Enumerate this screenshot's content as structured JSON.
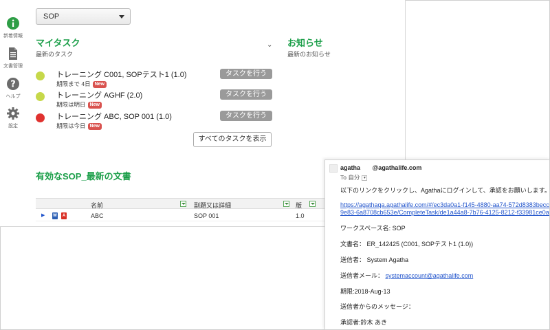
{
  "sidebar": {
    "items": [
      {
        "label": "新着情報",
        "icon": "info-icon"
      },
      {
        "label": "文書管理",
        "icon": "document-icon"
      },
      {
        "label": "ヘルプ",
        "icon": "help-icon"
      },
      {
        "label": "設定",
        "icon": "gear-icon"
      }
    ]
  },
  "workspace_select": {
    "value": "SOP"
  },
  "my_tasks": {
    "title": "マイタスク",
    "subtitle": "最新のタスク",
    "tasks": [
      {
        "title": "トレーニング C001, SOPテスト1 (1.0)",
        "due": "期限まで 4日",
        "badge": "New",
        "status_color": "#c6d84a",
        "action": "タスクを行う"
      },
      {
        "title": "トレーニング AGHF (2.0)",
        "due": "期限は明日",
        "badge": "New",
        "status_color": "#c6d84a",
        "action": "タスクを行う"
      },
      {
        "title": "トレーニング ABC, SOP 001 (1.0)",
        "due": "期限は今日",
        "badge": "New",
        "status_color": "#e0322f",
        "action": "タスクを行う"
      }
    ],
    "show_all": "すべてのタスクを表示"
  },
  "notices": {
    "title": "お知らせ",
    "subtitle": "最新のお知らせ"
  },
  "latest_docs": {
    "title": "有効なSOP_最新の文書",
    "columns": [
      "名前",
      "副題又は詳細",
      "版"
    ],
    "rows": [
      {
        "name": "ABC",
        "detail": "SOP 001",
        "version": "1.0"
      }
    ]
  },
  "email": {
    "from_name": "agatha",
    "from_domain": "@agathalife.com",
    "to": "To 自分",
    "intro": "以下のリンクをクリックし、Agathaにログインして、承認をお願いします。",
    "link_line1": "https://agathaqa.agathalife.com/#/ec3da0a1-f145-4880-aa74-572d8383becc/ec",
    "link_line2": "9e83-6a8708cb653e/CompleteTask/de1a44a8-7b76-4125-8212-f33981ce0af6",
    "workspace": "ワークスペース名: SOP",
    "doc_name": "文書名： ER_142425 (C001, SOPテスト1 (1.0))",
    "sender": "送信者： System Agatha",
    "sender_mail_label": "送信者メール：",
    "sender_mail": "systemaccount@agathalife.com",
    "deadline": "期限:2018-Aug-13",
    "message_label": "送信者からのメッセージ：",
    "approver": "承認者:鈴木 あき"
  },
  "colors": {
    "accent_green": "#1a9e48",
    "badge_red": "#d9534f"
  }
}
